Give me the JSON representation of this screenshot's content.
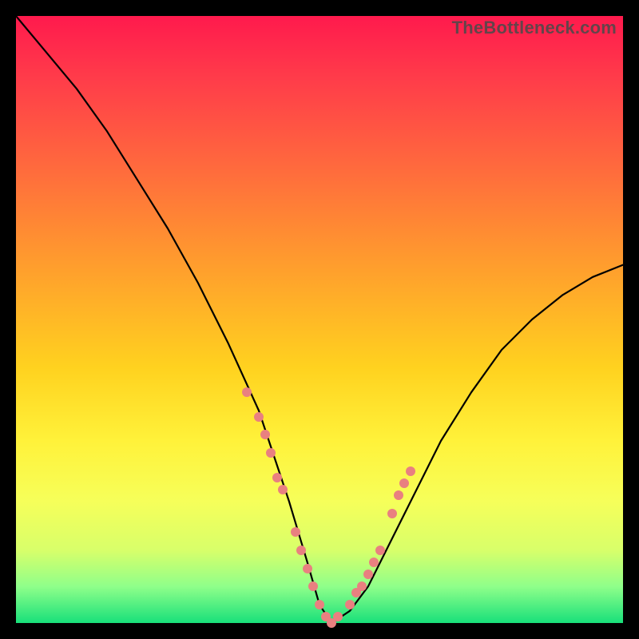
{
  "watermark": "TheBottleneck.com",
  "chart_data": {
    "type": "line",
    "title": "",
    "xlabel": "",
    "ylabel": "",
    "xlim": [
      0,
      100
    ],
    "ylim": [
      0,
      100
    ],
    "grid": false,
    "legend": false,
    "series": [
      {
        "name": "bottleneck-curve",
        "color": "#000000",
        "x": [
          0,
          5,
          10,
          15,
          20,
          25,
          30,
          35,
          40,
          45,
          48,
          50,
          52,
          55,
          58,
          60,
          65,
          70,
          75,
          80,
          85,
          90,
          95,
          100
        ],
        "y": [
          100,
          94,
          88,
          81,
          73,
          65,
          56,
          46,
          35,
          20,
          10,
          3,
          0,
          2,
          6,
          10,
          20,
          30,
          38,
          45,
          50,
          54,
          57,
          59
        ]
      }
    ],
    "markers": {
      "name": "highlighted-points",
      "color": "#e98080",
      "points": [
        {
          "x": 38,
          "y": 38
        },
        {
          "x": 40,
          "y": 34
        },
        {
          "x": 41,
          "y": 31
        },
        {
          "x": 42,
          "y": 28
        },
        {
          "x": 43,
          "y": 24
        },
        {
          "x": 44,
          "y": 22
        },
        {
          "x": 46,
          "y": 15
        },
        {
          "x": 47,
          "y": 12
        },
        {
          "x": 48,
          "y": 9
        },
        {
          "x": 49,
          "y": 6
        },
        {
          "x": 50,
          "y": 3
        },
        {
          "x": 51,
          "y": 1
        },
        {
          "x": 52,
          "y": 0
        },
        {
          "x": 53,
          "y": 1
        },
        {
          "x": 55,
          "y": 3
        },
        {
          "x": 56,
          "y": 5
        },
        {
          "x": 57,
          "y": 6
        },
        {
          "x": 58,
          "y": 8
        },
        {
          "x": 59,
          "y": 10
        },
        {
          "x": 60,
          "y": 12
        },
        {
          "x": 62,
          "y": 18
        },
        {
          "x": 63,
          "y": 21
        },
        {
          "x": 64,
          "y": 23
        },
        {
          "x": 65,
          "y": 25
        }
      ]
    },
    "background_gradient": {
      "top": "#ff1a4d",
      "bottom": "#18e07a"
    }
  }
}
